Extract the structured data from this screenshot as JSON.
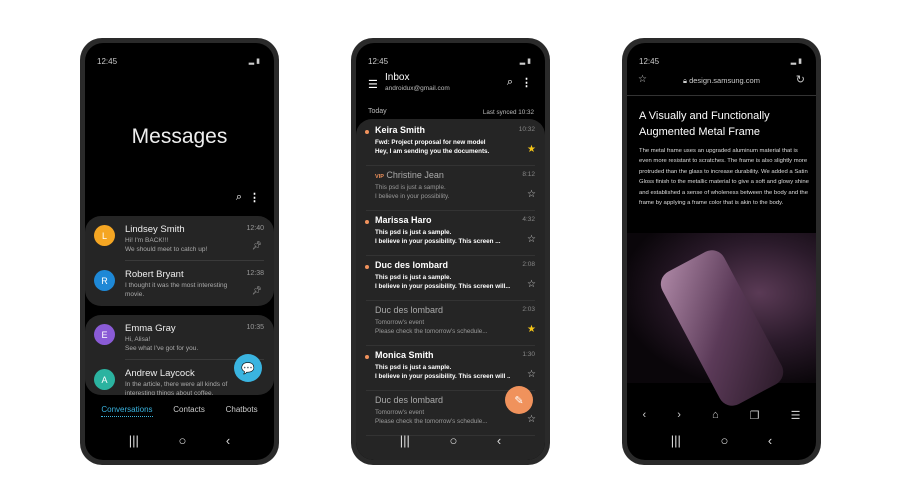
{
  "messages": {
    "time": "12:45",
    "title": "Messages",
    "conversations": [
      {
        "name": "Lindsey Smith",
        "initial": "L",
        "time": "12:40",
        "line1": "Hi! I'm BACK!!!",
        "line2": "We should meet to catch up!",
        "pinned": true,
        "color": "#f5a623"
      },
      {
        "name": "Robert Bryant",
        "initial": "R",
        "time": "12:38",
        "line1": "I thought it was the most interesting",
        "line2": "movie.",
        "pinned": true,
        "color": "#1e88d6"
      },
      {
        "name": "Emma Gray",
        "initial": "E",
        "time": "10:35",
        "line1": "Hi, Alisa!",
        "line2": "See what I've got for you.",
        "pinned": false,
        "color": "#8a5bd6"
      },
      {
        "name": "Andrew Laycock",
        "initial": "A",
        "time": "",
        "line1": "In the article, there were all kinds of",
        "line2": "interesting things about coffee.",
        "pinned": false,
        "color": "#2bb3a0"
      }
    ],
    "tabs": [
      "Conversations",
      "Contacts",
      "Chatbots"
    ],
    "active_tab": "Conversations",
    "accent": "#3ab4e0"
  },
  "email": {
    "time": "12:45",
    "folder": "Inbox",
    "account": "androidux@gmail.com",
    "section": "Today",
    "synced": "Last synced 10:32",
    "mails": [
      {
        "from": "Keira Smith",
        "time": "10:32",
        "line1": "Fwd: Project proposal for new model",
        "line2": "Hey, I am sending you the documents.",
        "unread": true,
        "starred": true,
        "vip": false
      },
      {
        "from": "Christine Jean",
        "time": "8:12",
        "line1": "This psd is just a sample.",
        "line2": "I believe in your possibility.",
        "unread": false,
        "starred": false,
        "vip": true
      },
      {
        "from": "Marissa Haro",
        "time": "4:32",
        "line1": "This psd is just a sample.",
        "line2": "I believe in your possibility. This screen ...",
        "unread": true,
        "starred": false,
        "vip": false
      },
      {
        "from": "Duc des lombard",
        "time": "2:08",
        "line1": "This psd is just a sample.",
        "line2": "I believe in your possibility. This screen will...",
        "unread": true,
        "starred": false,
        "vip": false
      },
      {
        "from": "Duc des lombard",
        "time": "2:03",
        "line1": "Tomorrow's event",
        "line2": "Please check the tomorrow's schedule...",
        "unread": false,
        "starred": true,
        "vip": false
      },
      {
        "from": "Monica Smith",
        "time": "1:30",
        "line1": "This psd is just a sample.",
        "line2": "I believe in your possibility. This screen will ...",
        "unread": true,
        "starred": false,
        "vip": false
      },
      {
        "from": "Duc des lombard",
        "time": "",
        "line1": "Tomorrow's event",
        "line2": "Please check the tomorrow's schedule...",
        "unread": false,
        "starred": false,
        "vip": false
      }
    ],
    "vip_label": "VIP",
    "accent": "#f0925c",
    "star_color": "#f5c518"
  },
  "browser": {
    "time": "12:45",
    "url": "design.samsung.com",
    "title": "A Visually and Functionally Augmented Metal Frame",
    "body": "The metal frame uses an upgraded aluminum material that is even more resistant to scratches. The frame is also slightly more protruded than the glass to increase durability. We added a Satin Gloss finish to the metallic material to give a soft and glowy shine and established a sense of wholeness between the body and the frame by applying a frame color that is akin to the body."
  }
}
